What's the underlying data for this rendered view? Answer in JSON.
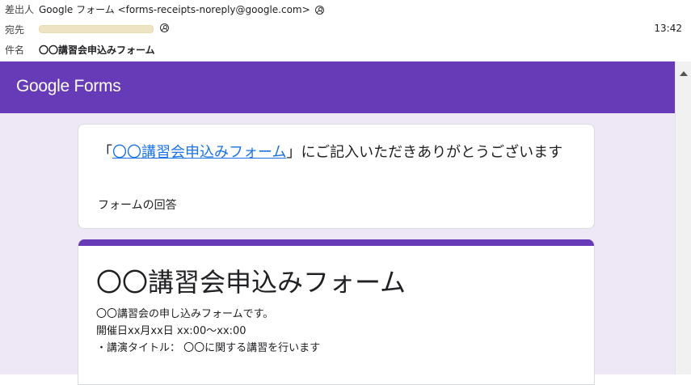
{
  "header": {
    "from_label": "差出人",
    "from_value": "Google フォーム <forms-receipts-noreply@google.com>",
    "to_label": "宛先",
    "time": "13:42",
    "subject_label": "件名",
    "subject_value": "〇〇講習会申込みフォーム"
  },
  "banner": {
    "logo_text": "Google Forms"
  },
  "confirmation": {
    "prefix": "「",
    "form_link": "〇〇講習会申込みフォーム",
    "suffix": "」にご記入いただきありがとうございます",
    "responses_label": "フォームの回答"
  },
  "form": {
    "title": "〇〇講習会申込みフォーム",
    "description": [
      "〇〇講習会の申し込みフォームです。",
      "開催日xx月xx日 xx:00〜xx:00",
      "・講演タイトル： 〇〇に関する講習を行います"
    ]
  },
  "colors": {
    "accent": "#673ab7",
    "background": "#ede7f6",
    "link": "#1a73e8"
  },
  "icons": [
    "contact-icon",
    "scroll-up-arrow-icon"
  ]
}
